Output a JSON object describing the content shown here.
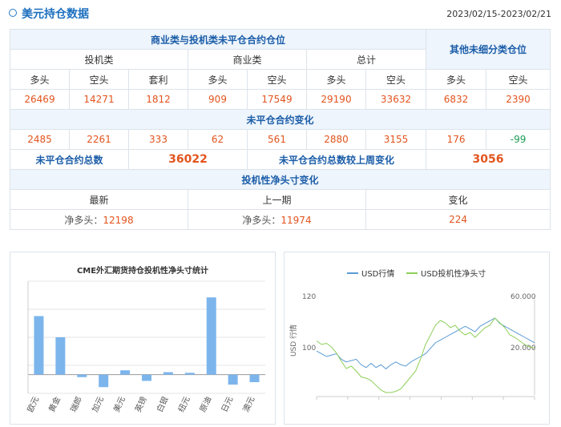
{
  "header": {
    "title": "美元持仓数据",
    "date_range": "2023/02/15-2023/02/21"
  },
  "table": {
    "section_main": "商业类与投机类未平仓合约仓位",
    "section_other": "其他未细分类仓位",
    "group_spec": "投机类",
    "group_comm": "商业类",
    "group_total": "总计",
    "col_long": "多头",
    "col_short": "空头",
    "col_arb": "套利",
    "row1": [
      "26469",
      "14271",
      "1812",
      "909",
      "17549",
      "29190",
      "33632",
      "6832",
      "2390"
    ],
    "section_change": "未平仓合约变化",
    "row2": [
      "2485",
      "2261",
      "333",
      "62",
      "561",
      "2880",
      "3155",
      "176",
      "-99"
    ],
    "oi_total_label": "未平仓合约总数",
    "oi_total_value": "36022",
    "oi_change_label": "未平仓合约总数较上周变化",
    "oi_change_value": "3056",
    "section_net": "投机性净头寸变化",
    "net_latest": "最新",
    "net_prev": "上一期",
    "net_change": "变化",
    "net_prefix": "净多头：",
    "net_latest_value": "12198",
    "net_prev_value": "11974",
    "net_change_value": "224"
  },
  "chart_data": [
    {
      "type": "bar",
      "title": "CME外汇期货持仓投机性净头寸统计",
      "categories": [
        "欧元",
        "黄金",
        "瑞郎",
        "加元",
        "美元",
        "英镑",
        "白银",
        "纽元",
        "原油",
        "日元",
        "澳元"
      ],
      "values": [
        47000,
        30000,
        -2000,
        -10000,
        3500,
        -5000,
        2000,
        1500,
        62000,
        -8000,
        -6000
      ],
      "ylim": [
        -15000,
        75000
      ],
      "colors": {
        "bar": "#7cb5ec",
        "grid": "#e6e6e6"
      }
    },
    {
      "type": "line",
      "legend": [
        "USD行情",
        "USD投机性净头寸"
      ],
      "ylabel": "USD 行情",
      "left_ticks": [
        "120",
        "100"
      ],
      "right_ticks": [
        "60.000",
        "20.000"
      ],
      "ylim_left": [
        85,
        120
      ],
      "ylim_right": [
        -20000,
        60000
      ],
      "colors": {
        "USD行情": "#5b9bd5",
        "USD投机性净头寸": "#8fcf5a"
      },
      "series": [
        {
          "name": "USD行情",
          "values": [
            101,
            100,
            99,
            99.5,
            100,
            98,
            97,
            97.5,
            98,
            96,
            95,
            96.5,
            95,
            96,
            94.5,
            96,
            97,
            96,
            95.5,
            97,
            98,
            99,
            100,
            102,
            104,
            105,
            106,
            107,
            108,
            109,
            110,
            109,
            108,
            110,
            111,
            112,
            113,
            111,
            110,
            109,
            108,
            107,
            106,
            105,
            104
          ]
        },
        {
          "name": "USD投机性净头寸",
          "values": [
            25000,
            22000,
            23000,
            20000,
            15000,
            8000,
            2000,
            4000,
            0,
            -5000,
            -6000,
            -8000,
            -12000,
            -16000,
            -18000,
            -18000,
            -17000,
            -15000,
            -10000,
            -5000,
            0,
            10000,
            22000,
            30000,
            38000,
            42000,
            40000,
            36000,
            38000,
            33000,
            30000,
            32000,
            28000,
            32000,
            36000,
            38000,
            44000,
            40000,
            36000,
            30000,
            28000,
            25000,
            22000,
            20000,
            19000
          ]
        }
      ]
    }
  ]
}
